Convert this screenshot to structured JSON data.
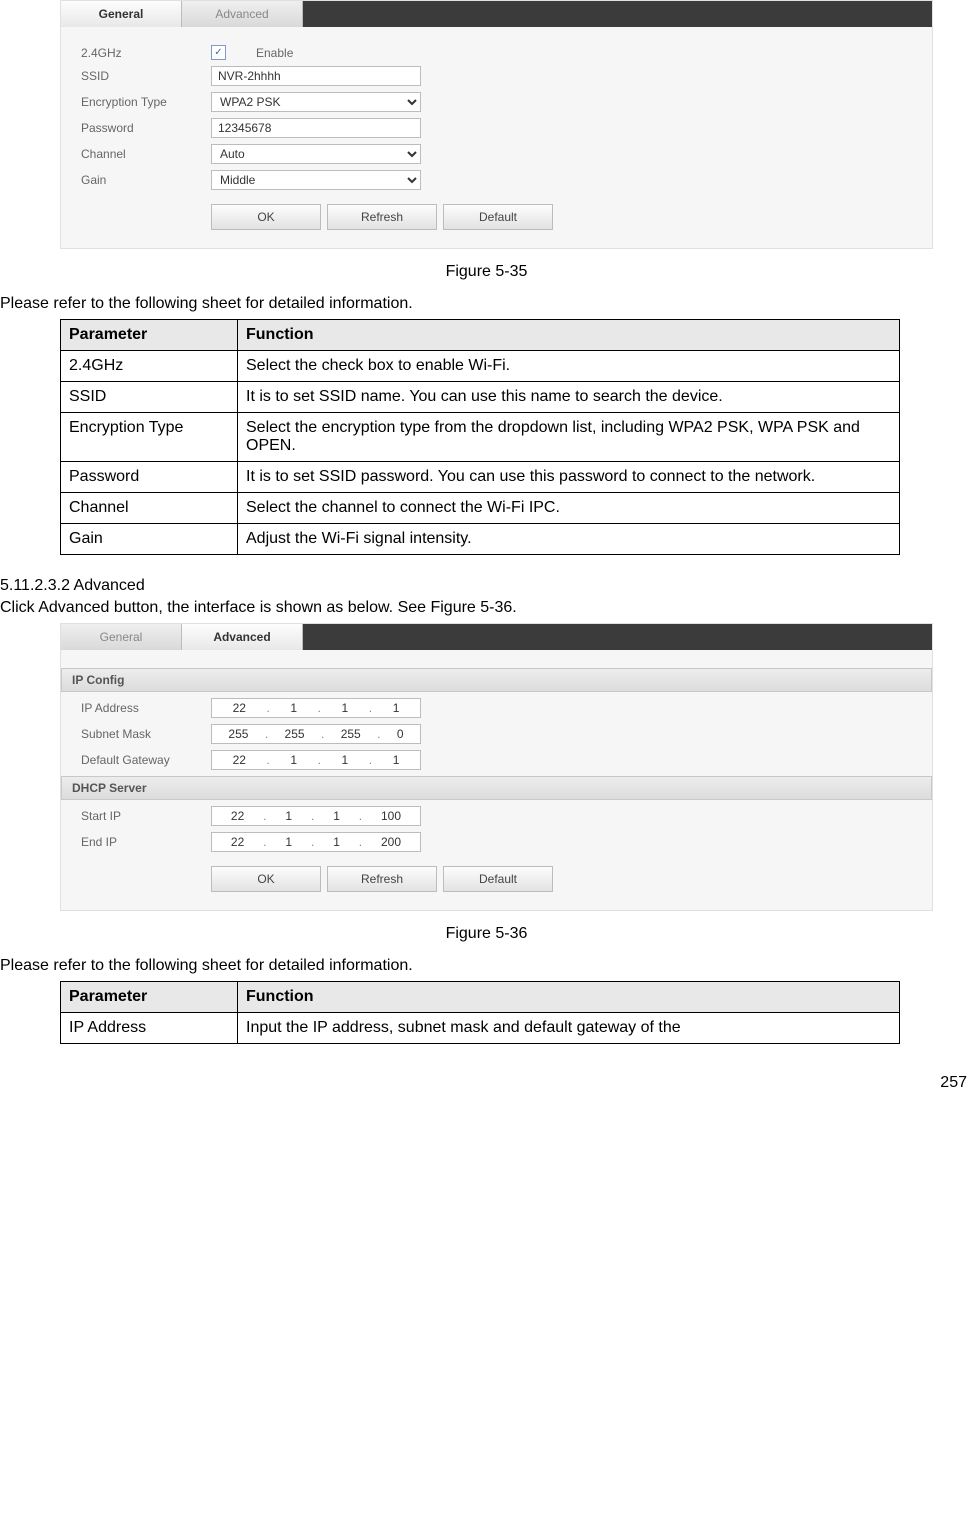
{
  "ui_general": {
    "tabs": {
      "general": "General",
      "advanced": "Advanced"
    },
    "rows": {
      "freq_label": "2.4GHz",
      "enable_label": "Enable",
      "ssid_label": "SSID",
      "ssid_value": "NVR-2hhhh",
      "enc_label": "Encryption Type",
      "enc_value": "WPA2 PSK",
      "pwd_label": "Password",
      "pwd_value": "12345678",
      "channel_label": "Channel",
      "channel_value": "Auto",
      "gain_label": "Gain",
      "gain_value": "Middle"
    },
    "buttons": {
      "ok": "OK",
      "refresh": "Refresh",
      "default": "Default"
    }
  },
  "caption1": "Figure 5-35",
  "intro1": "Please refer to the following sheet for detailed information.",
  "table1": {
    "h1": "Parameter",
    "h2": "Function",
    "rows": [
      {
        "p": "2.4GHz",
        "f": "Select the check box to enable Wi-Fi."
      },
      {
        "p": "SSID",
        "f": "It is to set SSID name. You can use this name to search the device."
      },
      {
        "p": "Encryption Type",
        "f": "Select the encryption type from the dropdown list, including WPA2 PSK, WPA PSK and OPEN."
      },
      {
        "p": "Password",
        "f": "It is to set SSID password. You can use this password to connect to the network."
      },
      {
        "p": "Channel",
        "f": "Select the channel to connect the Wi-Fi IPC."
      },
      {
        "p": "Gain",
        "f": "Adjust the Wi-Fi signal intensity."
      }
    ]
  },
  "heading2": "5.11.2.3.2 Advanced",
  "intro2": "Click Advanced button, the interface is shown as below. See Figure 5-36.",
  "ui_advanced": {
    "tabs": {
      "general": "General",
      "advanced": "Advanced"
    },
    "section_ip": "IP Config",
    "ip_label": "IP Address",
    "ip_value": [
      "22",
      "1",
      "1",
      "1"
    ],
    "mask_label": "Subnet Mask",
    "mask_value": [
      "255",
      "255",
      "255",
      "0"
    ],
    "gw_label": "Default Gateway",
    "gw_value": [
      "22",
      "1",
      "1",
      "1"
    ],
    "section_dhcp": "DHCP Server",
    "start_label": "Start IP",
    "start_value": [
      "22",
      "1",
      "1",
      "100"
    ],
    "end_label": "End IP",
    "end_value": [
      "22",
      "1",
      "1",
      "200"
    ],
    "buttons": {
      "ok": "OK",
      "refresh": "Refresh",
      "default": "Default"
    }
  },
  "caption2": "Figure 5-36",
  "intro3": "Please refer to the following sheet for detailed information.",
  "table2": {
    "h1": "Parameter",
    "h2": "Function",
    "rows": [
      {
        "p": "IP Address",
        "f": "Input the IP address, subnet mask and default gateway of the"
      }
    ]
  },
  "page_number": "257"
}
